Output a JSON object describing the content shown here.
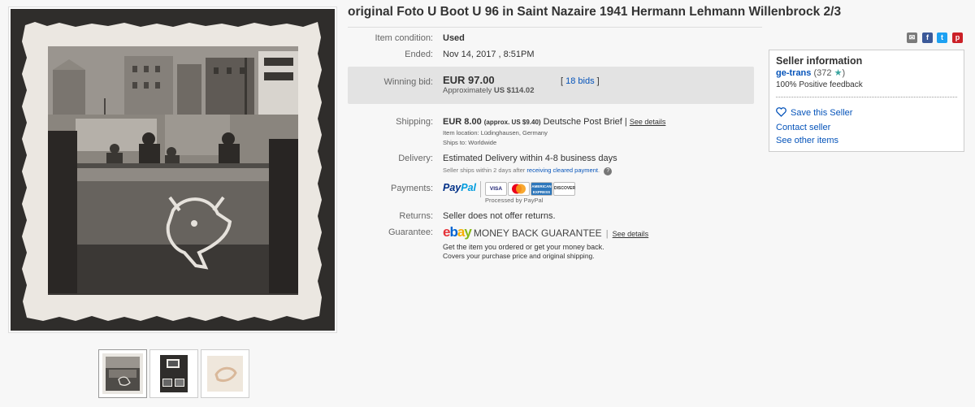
{
  "title": "original Foto U Boot U 96 in Saint Nazaire 1941 Hermann Lehmann Willenbrock 2/3",
  "details": {
    "condition_label": "Item condition:",
    "condition_value": "Used",
    "ended_label": "Ended:",
    "ended_value": "Nov 14, 2017 , 8:51PM",
    "winning_label": "Winning bid:",
    "winning_value": "EUR 97.00",
    "approx_prefix": "Approximately",
    "approx_value": "US $114.02",
    "bids": "18 bids",
    "shipping_label": "Shipping:",
    "shipping_value": "EUR 8.00",
    "shipping_approx": "(approx. US $9.40)",
    "shipping_service": "Deutsche Post Brief |",
    "see_details": "See details",
    "item_location": "Item location:  Lüdinghausen, Germany",
    "ships_to": "Ships to:  Worldwide",
    "delivery_label": "Delivery:",
    "delivery_value": "Estimated Delivery within 4-8 business days",
    "delivery_sub_prefix": "Seller ships within 2 days after",
    "delivery_sub_link": "receiving cleared payment",
    "delivery_sub_suffix": ".",
    "help_icon": "?",
    "payments_label": "Payments:",
    "paypal_1": "Pay",
    "paypal_2": "Pal",
    "processed_by": "Processed by PayPal",
    "returns_label": "Returns:",
    "returns_value": "Seller does not offer returns.",
    "guarantee_label": "Guarantee:",
    "ebay_e": "e",
    "ebay_b": "b",
    "ebay_a": "a",
    "ebay_y": "y",
    "mbg_text": "MONEY BACK GUARANTEE",
    "mbg_sep": "|",
    "mbg_line1": "Get the item you ordered or get your money back.",
    "mbg_line2": "Covers your purchase price and original shipping."
  },
  "cards": {
    "visa": "VISA",
    "mastercard": "",
    "amex": "AMERICAN EXPRESS",
    "discover": "DISCOVER"
  },
  "share": {
    "email": "✉",
    "facebook": "f",
    "twitter": "t",
    "pinterest": "p"
  },
  "seller": {
    "title": "Seller information",
    "name": "ge-trans",
    "score": "(372",
    "score_close": ")",
    "star": "★",
    "feedback": "100% Positive feedback",
    "save": "Save this Seller",
    "contact": "Contact seller",
    "other": "See other items"
  },
  "colors": {
    "link": "#0654ba",
    "bid_box": "#e3e3e3",
    "star": "#3aa5a0",
    "paypal_dark": "#003087",
    "paypal_light": "#009cde"
  }
}
